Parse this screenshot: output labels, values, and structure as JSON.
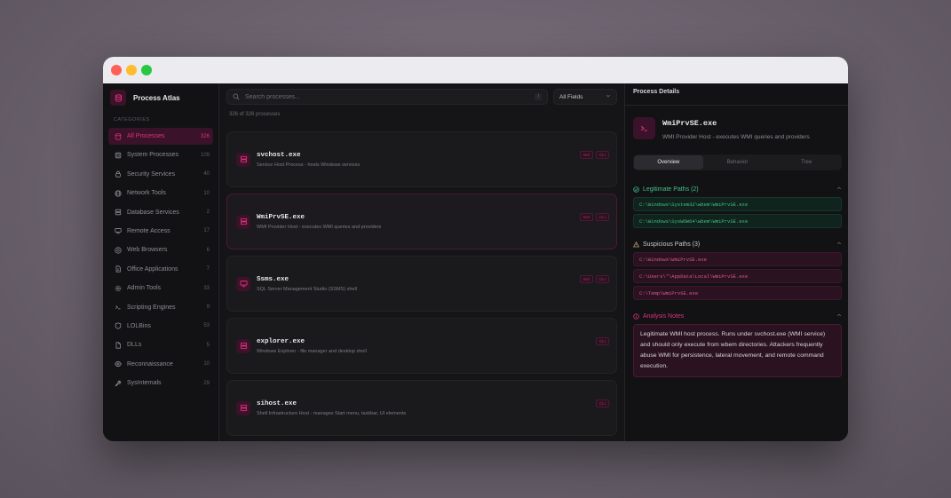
{
  "brand": {
    "title": "Process Atlas"
  },
  "sidebar": {
    "section_label": "CATEGORIES",
    "items": [
      {
        "label": "All Processes",
        "count": "326",
        "icon": "database-icon",
        "active": true
      },
      {
        "label": "System Processes",
        "count": "109",
        "icon": "cpu-icon"
      },
      {
        "label": "Security Services",
        "count": "40",
        "icon": "lock-icon"
      },
      {
        "label": "Network Tools",
        "count": "10",
        "icon": "globe-icon"
      },
      {
        "label": "Database Services",
        "count": "2",
        "icon": "server-icon"
      },
      {
        "label": "Remote Access",
        "count": "17",
        "icon": "remote-icon"
      },
      {
        "label": "Web Browsers",
        "count": "6",
        "icon": "browser-icon"
      },
      {
        "label": "Office Applications",
        "count": "7",
        "icon": "document-icon"
      },
      {
        "label": "Admin Tools",
        "count": "33",
        "icon": "gear-icon"
      },
      {
        "label": "Scripting Engines",
        "count": "9",
        "icon": "terminal-icon"
      },
      {
        "label": "LOLBins",
        "count": "53",
        "icon": "shield-icon"
      },
      {
        "label": "DLLs",
        "count": "5",
        "icon": "file-icon"
      },
      {
        "label": "Reconnaissance",
        "count": "10",
        "icon": "eye-icon"
      },
      {
        "label": "SysInternals",
        "count": "29",
        "icon": "wrench-icon"
      }
    ]
  },
  "search": {
    "placeholder": "Search processes...",
    "shortcut": "/",
    "field_select": "All Fields"
  },
  "results": {
    "count_text": "326 of 326 processes"
  },
  "processes": [
    {
      "name": "svchost.exe",
      "desc": "Service Host Process - hosts Windows services",
      "tags": [
        "Net",
        "CLI"
      ]
    },
    {
      "name": "WmiPrvSE.exe",
      "desc": "WMI Provider Host - executes WMI queries and providers",
      "tags": [
        "Net",
        "CLI"
      ]
    },
    {
      "name": "Ssms.exe",
      "desc": "SQL Server Management Studio (SSMS) shell",
      "tags": [
        "Net",
        "CLI"
      ]
    },
    {
      "name": "explorer.exe",
      "desc": "Windows Explorer - file manager and desktop shell",
      "tags": [
        "CLI"
      ]
    },
    {
      "name": "sihost.exe",
      "desc": "Shell Infrastructure Host - manages Start menu, taskbar, UI elements",
      "tags": [
        "CLI"
      ]
    }
  ],
  "details": {
    "panel_title": "Process Details",
    "name": "WmiPrvSE.exe",
    "desc": "WMI Provider Host - executes WMI queries and providers",
    "tabs": [
      "Overview",
      "Behavior",
      "Tree"
    ],
    "legit_title": "Legitimate Paths (2)",
    "legit_paths": [
      "C:\\Windows\\System32\\wbem\\WmiPrvSE.exe",
      "C:\\Windows\\SysWOW64\\wbem\\WmiPrvSE.exe"
    ],
    "susp_title": "Suspicious Paths (3)",
    "susp_paths": [
      "C:\\Windows\\WmiPrvSE.exe",
      "C:\\Users\\*\\AppData\\Local\\WmiPrvSE.exe",
      "C:\\Temp\\WmiPrvSE.exe"
    ],
    "notes_title": "Analysis Notes",
    "notes": "Legitimate WMI host process. Runs under svchost.exe (WMI service) and should only execute from wbem directories. Attackers frequently abuse WMI for persistence, lateral movement, and remote command execution."
  },
  "colors": {
    "accent": "#e0317d",
    "legit": "#45c08a",
    "warn": "#c0a070"
  }
}
